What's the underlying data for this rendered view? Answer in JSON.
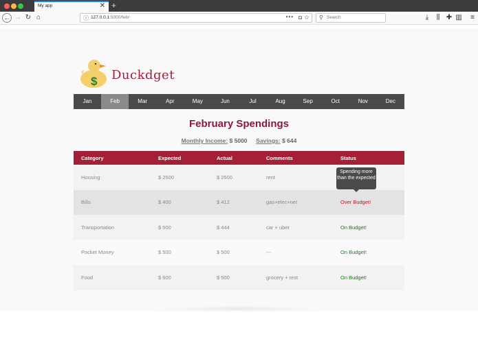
{
  "browser": {
    "tab_title": "My app",
    "tab_close": "✕",
    "new_tab": "+",
    "url_host": "127.0.0.1",
    "url_path": ":5000/feb/",
    "url_more": "•••",
    "search_placeholder": "Search",
    "nav_icons": [
      "back-icon",
      "forward-icon",
      "reload-icon",
      "home-icon"
    ],
    "toolbar_icons": [
      "download-icon",
      "library-icon",
      "extensions-icon",
      "sidebar-icon",
      "menu-icon"
    ]
  },
  "app": {
    "logo_text": "Duckdget",
    "logo_dollar": "$",
    "months": [
      "Jan",
      "Feb",
      "Mar",
      "Apr",
      "May",
      "Jun",
      "Jul",
      "Aug",
      "Sep",
      "Oct",
      "Nov",
      "Dec"
    ],
    "active_month": "Feb",
    "heading": "February Spendings",
    "income_label": "Monthly Income:",
    "income_value": "$ 5000",
    "savings_label": "Savings:",
    "savings_value": "$ 644"
  },
  "table": {
    "headers": [
      "Category",
      "Expected",
      "Actual",
      "Comments",
      "Status"
    ],
    "rows": [
      {
        "category": "Housing",
        "expected": "$ 2500",
        "actual": "$ 2500",
        "comments": "rent",
        "status": ""
      },
      {
        "category": "Bills",
        "expected": "$ 400",
        "actual": "$ 412",
        "comments": "gas+elec+net",
        "status": "Over Budget!"
      },
      {
        "category": "Transportation",
        "expected": "$ 500",
        "actual": "$ 444",
        "comments": "car + uber",
        "status": "On Budget!"
      },
      {
        "category": "Pocket Money",
        "expected": "$ 500",
        "actual": "$ 500",
        "comments": "---",
        "status": "On Budget!"
      },
      {
        "category": "Food",
        "expected": "$ 600",
        "actual": "$ 500",
        "comments": "grocery + rest",
        "status": "On Budget!"
      }
    ],
    "tooltip": "Spending more than the expected"
  },
  "colors": {
    "accent": "#a32036",
    "heading": "#8b1a3a",
    "over": "#c9102a",
    "ok": "#1f7a1f",
    "nav_bg": "#4a4a4a"
  }
}
